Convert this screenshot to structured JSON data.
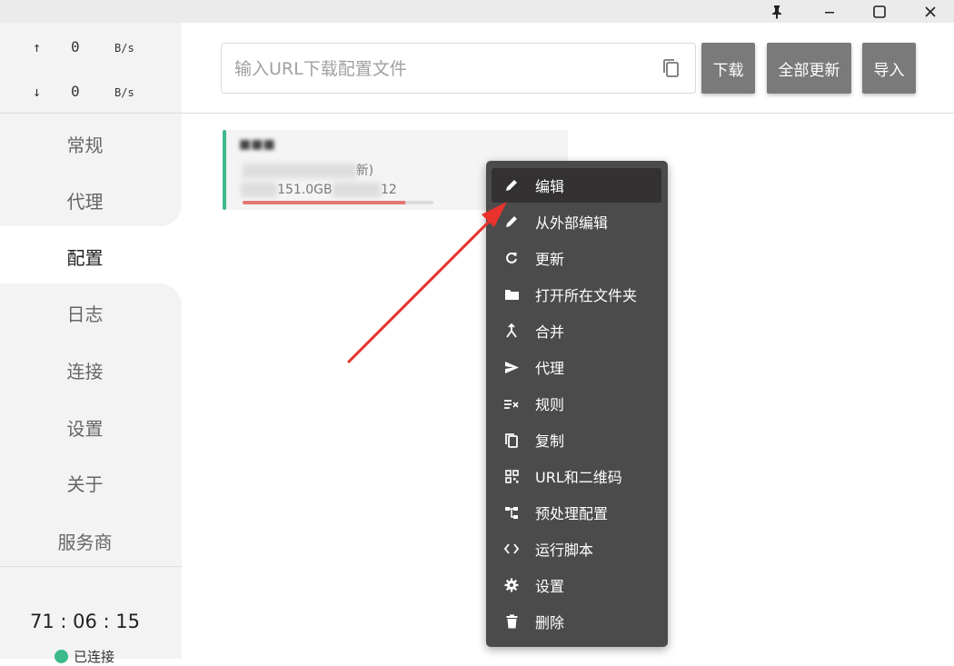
{
  "window": {
    "pin_icon": "pin-icon",
    "minimize_icon": "minimize-icon",
    "maximize_icon": "maximize-icon",
    "close_icon": "close-icon"
  },
  "sidebar": {
    "upload": {
      "arrow": "↑",
      "value": "0",
      "unit": "B/s"
    },
    "download": {
      "arrow": "↓",
      "value": "0",
      "unit": "B/s"
    },
    "items": [
      {
        "label": "常规"
      },
      {
        "label": "代理"
      },
      {
        "label": "配置"
      },
      {
        "label": "日志"
      },
      {
        "label": "连接"
      },
      {
        "label": "设置"
      },
      {
        "label": "关于"
      },
      {
        "label": "服务商"
      }
    ],
    "active_index": 2,
    "timer": "71 : 06 : 15",
    "status": "已连接",
    "status_color": "#3dba8a"
  },
  "header": {
    "url_placeholder": "输入URL下载配置文件",
    "url_value": "",
    "download_label": "下载",
    "update_all_label": "全部更新",
    "import_label": "导入"
  },
  "profile_card": {
    "title": "■■■",
    "subtitle_end": "新)",
    "traffic_middle": "151.0GB",
    "traffic_end": "12",
    "usage_fraction": 0.85,
    "accent_color": "#3dba8a"
  },
  "context_menu": {
    "items": [
      {
        "label": "编辑",
        "icon": "pencil-icon"
      },
      {
        "label": "从外部编辑",
        "icon": "pencil-icon"
      },
      {
        "label": "更新",
        "icon": "refresh-icon"
      },
      {
        "label": "打开所在文件夹",
        "icon": "folder-icon"
      },
      {
        "label": "合并",
        "icon": "merge-icon"
      },
      {
        "label": "代理",
        "icon": "send-icon"
      },
      {
        "label": "规则",
        "icon": "rules-icon"
      },
      {
        "label": "复制",
        "icon": "copy-icon"
      },
      {
        "label": "URL和二维码",
        "icon": "qrcode-icon"
      },
      {
        "label": "预处理配置",
        "icon": "tree-icon"
      },
      {
        "label": "运行脚本",
        "icon": "code-icon"
      },
      {
        "label": "设置",
        "icon": "gear-icon"
      },
      {
        "label": "删除",
        "icon": "trash-icon"
      }
    ],
    "highlighted_index": 0
  }
}
